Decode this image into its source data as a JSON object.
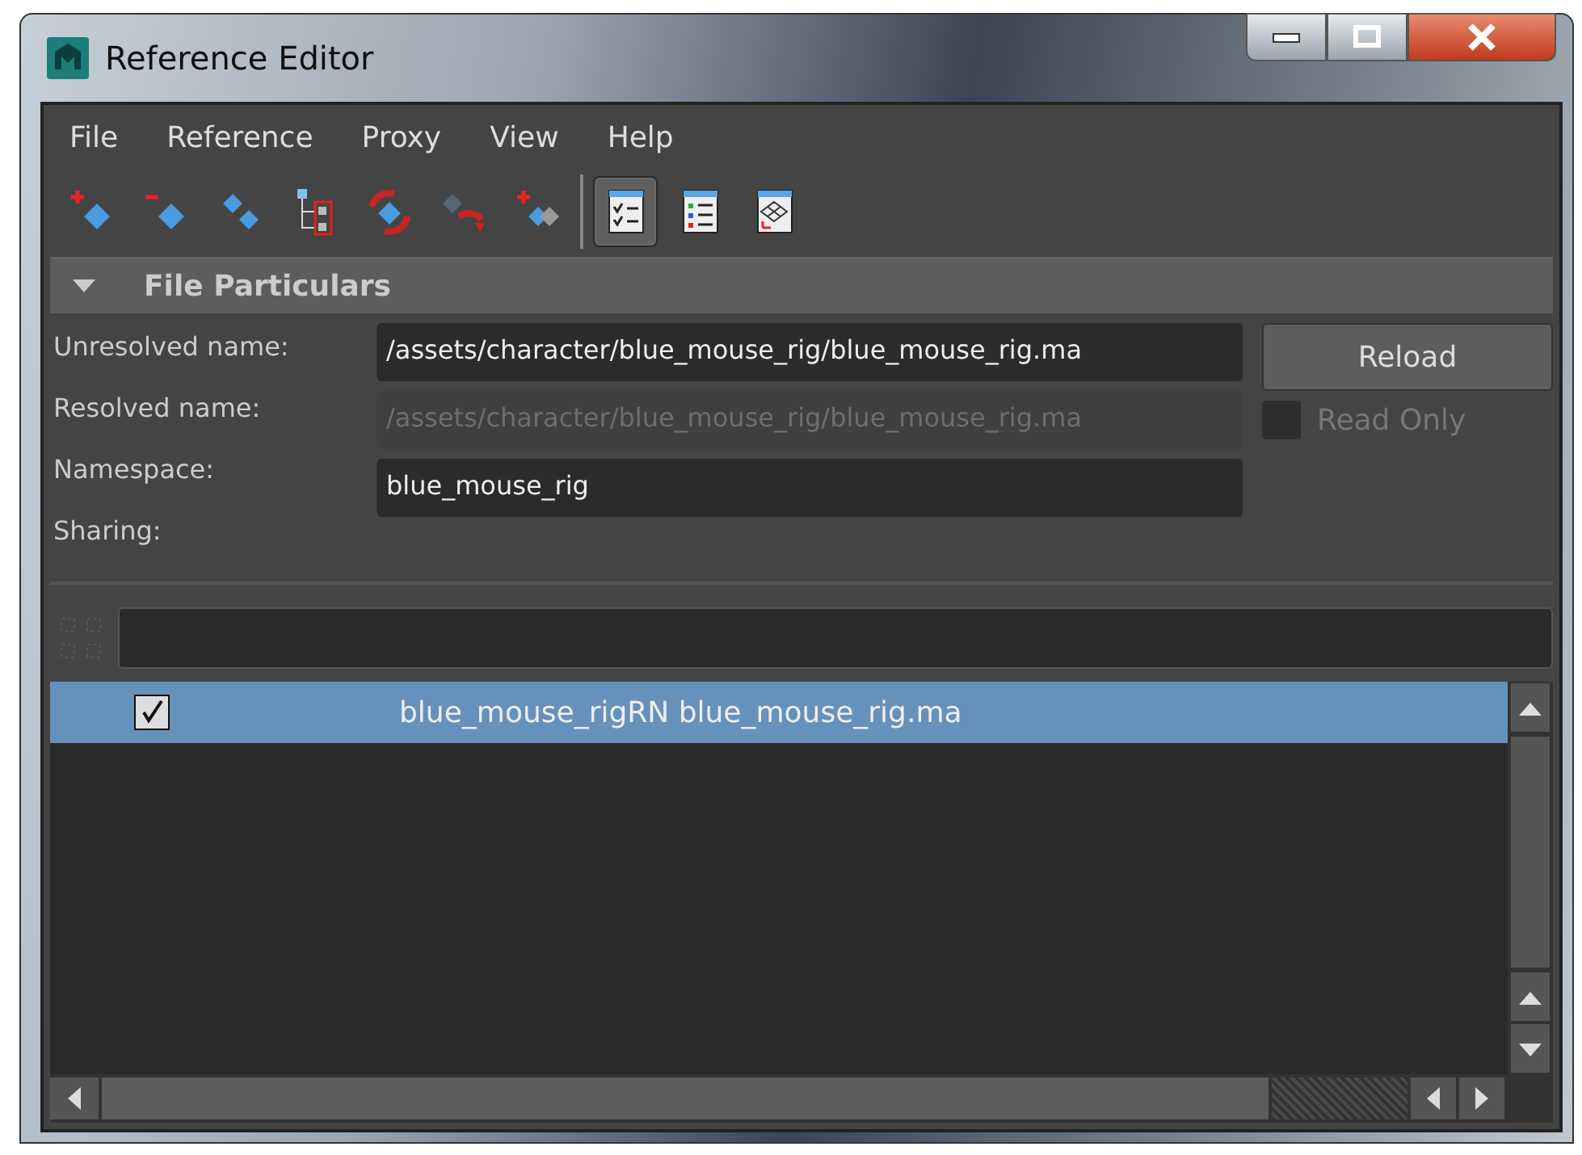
{
  "window": {
    "title": "Reference Editor"
  },
  "menu": [
    "File",
    "Reference",
    "Proxy",
    "View",
    "Help"
  ],
  "toolbar": [
    {
      "kind": "add-ref"
    },
    {
      "kind": "remove-ref"
    },
    {
      "kind": "duplicate"
    },
    {
      "kind": "tree"
    },
    {
      "kind": "reload"
    },
    {
      "kind": "unload"
    },
    {
      "kind": "add-proxy"
    },
    {
      "kind": "separator"
    },
    {
      "kind": "check-list",
      "selected": true
    },
    {
      "kind": "color-list",
      "selected": false
    },
    {
      "kind": "scene",
      "selected": false
    }
  ],
  "file_particulars": {
    "title": "File Particulars",
    "expanded": true,
    "fields": [
      {
        "label": "Unresolved name:",
        "value": "/assets/character/blue_mouse_rig/blue_mouse_rig.ma",
        "disabled": false
      },
      {
        "label": "Resolved name:",
        "value": "/assets/character/blue_mouse_rig/blue_mouse_rig.ma",
        "disabled": true
      },
      {
        "label": "Namespace:",
        "value": "blue_mouse_rig",
        "disabled": false
      },
      {
        "label": "Sharing:"
      }
    ],
    "reload_button": "Reload",
    "read_only": {
      "label": "Read Only",
      "checked": false,
      "disabled": true
    }
  },
  "references": [
    {
      "text": "blue_mouse_rigRN blue_mouse_rig.ma",
      "checked": true,
      "selected": true
    }
  ]
}
